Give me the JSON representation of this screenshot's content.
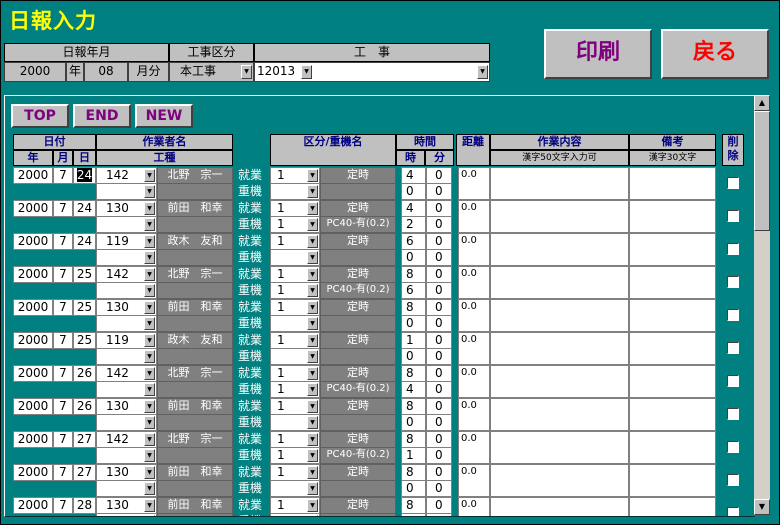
{
  "window": {
    "title": "日報入力"
  },
  "header": {
    "date_label": "日報年月",
    "year": "2000",
    "year_unit": "年",
    "month": "08",
    "month_unit": "月分",
    "work_type_label": "工事区分",
    "work_type_value": "本工事",
    "project_label": "工　事",
    "project_code": "12013"
  },
  "buttons": {
    "print": "印刷",
    "back": "戻る",
    "top": "TOP",
    "end": "END",
    "new": "NEW"
  },
  "columns": {
    "date": "日付",
    "year": "年",
    "month": "月",
    "day": "日",
    "worker": "作業者名",
    "category": "工種",
    "kubun": "区分/重機名",
    "time": "時間",
    "hours": "時",
    "minutes": "分",
    "distance": "距離",
    "content": "作業内容",
    "content_note": "漢字50文字入力可",
    "remarks": "備考",
    "remarks_note": "漢字30文字",
    "delete": "削除"
  },
  "row_labels": {
    "work": "就業",
    "machine": "重機"
  },
  "rows": [
    {
      "year": "2000",
      "month": "7",
      "day": "24",
      "code": "142",
      "name": "北野　宗一",
      "k1": "1",
      "n1": "定時",
      "h1": "4",
      "m1": "0",
      "k2": "",
      "n2": "",
      "h2": "0",
      "m2": "0",
      "dist": "0.0"
    },
    {
      "year": "2000",
      "month": "7",
      "day": "24",
      "code": "130",
      "name": "前田　和幸",
      "k1": "1",
      "n1": "定時",
      "h1": "4",
      "m1": "0",
      "k2": "1",
      "n2": "PC40-有(0.2)",
      "h2": "2",
      "m2": "0",
      "dist": "0.0"
    },
    {
      "year": "2000",
      "month": "7",
      "day": "24",
      "code": "119",
      "name": "政木　友和",
      "k1": "1",
      "n1": "定時",
      "h1": "6",
      "m1": "0",
      "k2": "",
      "n2": "",
      "h2": "0",
      "m2": "0",
      "dist": "0.0"
    },
    {
      "year": "2000",
      "month": "7",
      "day": "25",
      "code": "142",
      "name": "北野　宗一",
      "k1": "1",
      "n1": "定時",
      "h1": "8",
      "m1": "0",
      "k2": "1",
      "n2": "PC40-有(0.2)",
      "h2": "6",
      "m2": "0",
      "dist": "0.0"
    },
    {
      "year": "2000",
      "month": "7",
      "day": "25",
      "code": "130",
      "name": "前田　和幸",
      "k1": "1",
      "n1": "定時",
      "h1": "8",
      "m1": "0",
      "k2": "",
      "n2": "",
      "h2": "0",
      "m2": "0",
      "dist": "0.0"
    },
    {
      "year": "2000",
      "month": "7",
      "day": "25",
      "code": "119",
      "name": "政木　友和",
      "k1": "1",
      "n1": "定時",
      "h1": "1",
      "m1": "0",
      "k2": "",
      "n2": "",
      "h2": "0",
      "m2": "0",
      "dist": "0.0"
    },
    {
      "year": "2000",
      "month": "7",
      "day": "26",
      "code": "142",
      "name": "北野　宗一",
      "k1": "1",
      "n1": "定時",
      "h1": "8",
      "m1": "0",
      "k2": "1",
      "n2": "PC40-有(0.2)",
      "h2": "4",
      "m2": "0",
      "dist": "0.0"
    },
    {
      "year": "2000",
      "month": "7",
      "day": "26",
      "code": "130",
      "name": "前田　和幸",
      "k1": "1",
      "n1": "定時",
      "h1": "8",
      "m1": "0",
      "k2": "",
      "n2": "",
      "h2": "0",
      "m2": "0",
      "dist": "0.0"
    },
    {
      "year": "2000",
      "month": "7",
      "day": "27",
      "code": "142",
      "name": "北野　宗一",
      "k1": "1",
      "n1": "定時",
      "h1": "8",
      "m1": "0",
      "k2": "1",
      "n2": "PC40-有(0.2)",
      "h2": "1",
      "m2": "0",
      "dist": "0.0"
    },
    {
      "year": "2000",
      "month": "7",
      "day": "27",
      "code": "130",
      "name": "前田　和幸",
      "k1": "1",
      "n1": "定時",
      "h1": "8",
      "m1": "0",
      "k2": "",
      "n2": "",
      "h2": "0",
      "m2": "0",
      "dist": "0.0"
    },
    {
      "year": "2000",
      "month": "7",
      "day": "28",
      "code": "130",
      "name": "前田　和幸",
      "k1": "1",
      "n1": "定時",
      "h1": "8",
      "m1": "0",
      "k2": "",
      "n2": "",
      "h2": "",
      "m2": "",
      "dist": "0.0"
    }
  ]
}
